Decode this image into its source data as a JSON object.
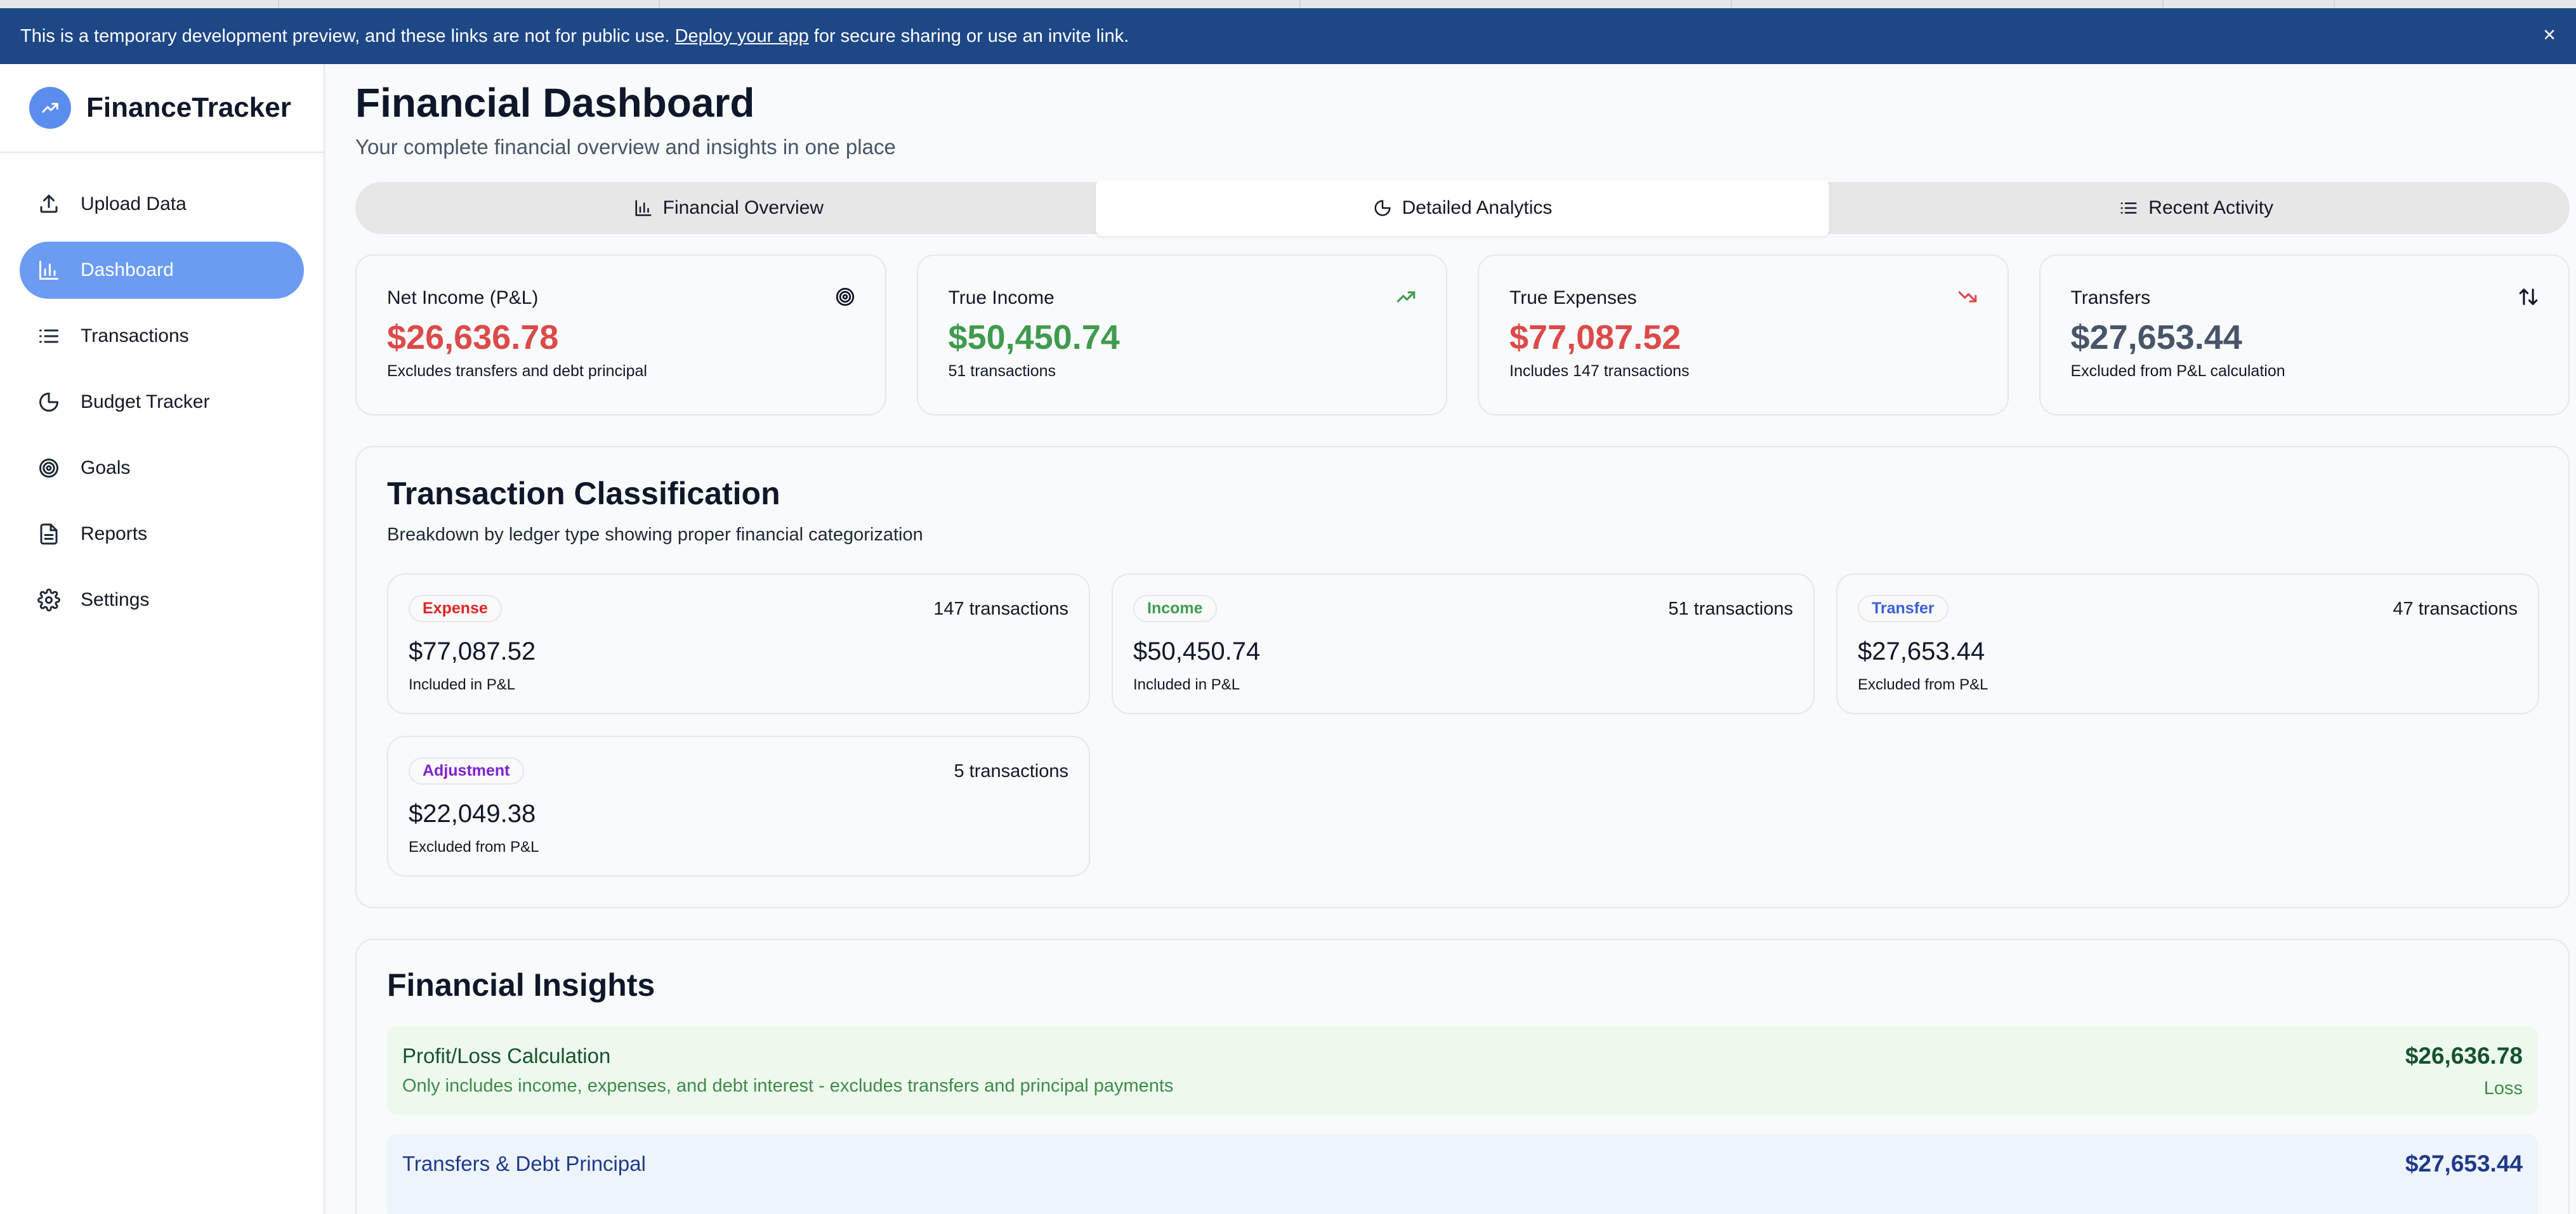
{
  "banner": {
    "text_before": "This is a temporary development preview, and these links are not for public use.",
    "link": "Deploy your app",
    "text_after": "for secure sharing or use an invite link.",
    "close": "×"
  },
  "sidebar": {
    "brand": "FinanceTracker",
    "items": [
      {
        "label": "Upload Data",
        "icon": "upload-icon"
      },
      {
        "label": "Dashboard",
        "icon": "bar-chart-icon",
        "active": true
      },
      {
        "label": "Transactions",
        "icon": "list-icon"
      },
      {
        "label": "Budget Tracker",
        "icon": "pie-chart-icon"
      },
      {
        "label": "Goals",
        "icon": "target-icon"
      },
      {
        "label": "Reports",
        "icon": "file-text-icon"
      },
      {
        "label": "Settings",
        "icon": "gear-icon"
      }
    ]
  },
  "header": {
    "title": "Financial Dashboard",
    "subtitle": "Your complete financial overview and insights in one place"
  },
  "tabs": [
    {
      "label": "Financial Overview",
      "icon": "bar-chart-icon"
    },
    {
      "label": "Detailed Analytics",
      "icon": "pie-chart-icon",
      "active": true
    },
    {
      "label": "Recent Activity",
      "icon": "list-icon"
    }
  ],
  "stats": [
    {
      "label": "Net Income (P&L)",
      "value": "$26,636.78",
      "note": "Excludes transfers and debt principal",
      "icon": "target-icon",
      "color": "#dc4a4a"
    },
    {
      "label": "True Income",
      "value": "$50,450.74",
      "note": "51 transactions",
      "icon": "trending-up-icon",
      "color": "#3f9b4f"
    },
    {
      "label": "True Expenses",
      "value": "$77,087.52",
      "note": "Includes 147 transactions",
      "icon": "trending-down-icon",
      "color": "#dc4a4a"
    },
    {
      "label": "Transfers",
      "value": "$27,653.44",
      "note": "Excluded from P&L calculation",
      "icon": "arrows-up-down-icon",
      "color": "#475569"
    }
  ],
  "classification": {
    "title": "Transaction Classification",
    "description": "Breakdown by ledger type showing proper financial categorization",
    "items": [
      {
        "badge": "Expense",
        "count": "147 transactions",
        "amount": "$77,087.52",
        "pl": "Included in P&L",
        "color": "#dc2626"
      },
      {
        "badge": "Income",
        "count": "51 transactions",
        "amount": "$50,450.74",
        "pl": "Included in P&L",
        "color": "#3f9b4f"
      },
      {
        "badge": "Transfer",
        "count": "47 transactions",
        "amount": "$27,653.44",
        "pl": "Excluded from P&L",
        "color": "#3b5fd9"
      },
      {
        "badge": "Adjustment",
        "count": "5 transactions",
        "amount": "$22,049.38",
        "pl": "Excluded from P&L",
        "color": "#7e22ce"
      }
    ]
  },
  "insights": {
    "title": "Financial Insights",
    "items": [
      {
        "title": "Profit/Loss Calculation",
        "subtitle": "Only includes income, expenses, and debt interest - excludes transfers and principal payments",
        "amount": "$26,636.78",
        "label": "Loss"
      },
      {
        "title": "Transfers & Debt Principal",
        "amount": "$27,653.44"
      }
    ]
  }
}
